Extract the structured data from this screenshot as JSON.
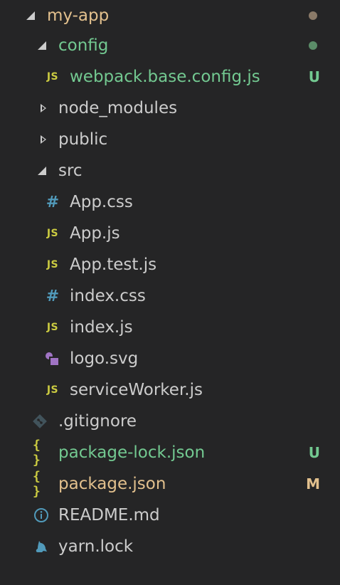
{
  "colors": {
    "background": "#252526",
    "default_text": "#cccccc",
    "untracked": "#73c991",
    "modified": "#e2c08d",
    "js": "#cbcb41",
    "css": "#519aba",
    "svg": "#a074c4",
    "git": "#41535b",
    "info": "#519aba"
  },
  "tree": {
    "root": {
      "label": "my-app",
      "icon": "chevron-down-icon"
    },
    "config": {
      "label": "config",
      "icon": "chevron-down-icon"
    },
    "webpack": {
      "label": "webpack.base.config.js",
      "icon": "js-file-icon",
      "badge_icon": "JS",
      "status": "U"
    },
    "node_modules": {
      "label": "node_modules",
      "icon": "chevron-right-icon"
    },
    "public": {
      "label": "public",
      "icon": "chevron-right-icon"
    },
    "src": {
      "label": "src",
      "icon": "chevron-down-icon"
    },
    "app_css": {
      "label": "App.css",
      "icon": "css-file-icon",
      "badge_icon": "#"
    },
    "app_js": {
      "label": "App.js",
      "icon": "js-file-icon",
      "badge_icon": "JS"
    },
    "app_test_js": {
      "label": "App.test.js",
      "icon": "js-file-icon",
      "badge_icon": "JS"
    },
    "index_css": {
      "label": "index.css",
      "icon": "css-file-icon",
      "badge_icon": "#"
    },
    "index_js": {
      "label": "index.js",
      "icon": "js-file-icon",
      "badge_icon": "JS"
    },
    "logo_svg": {
      "label": "logo.svg",
      "icon": "svg-file-icon"
    },
    "service_worker": {
      "label": "serviceWorker.js",
      "icon": "js-file-icon",
      "badge_icon": "JS"
    },
    "gitignore": {
      "label": ".gitignore",
      "icon": "git-icon"
    },
    "package_lock": {
      "label": "package-lock.json",
      "icon": "json-file-icon",
      "badge_icon": "{ }",
      "status": "U"
    },
    "package_json": {
      "label": "package.json",
      "icon": "json-file-icon",
      "badge_icon": "{ }",
      "status": "M"
    },
    "readme": {
      "label": "README.md",
      "icon": "info-icon"
    },
    "yarn_lock": {
      "label": "yarn.lock",
      "icon": "yarn-icon"
    }
  }
}
